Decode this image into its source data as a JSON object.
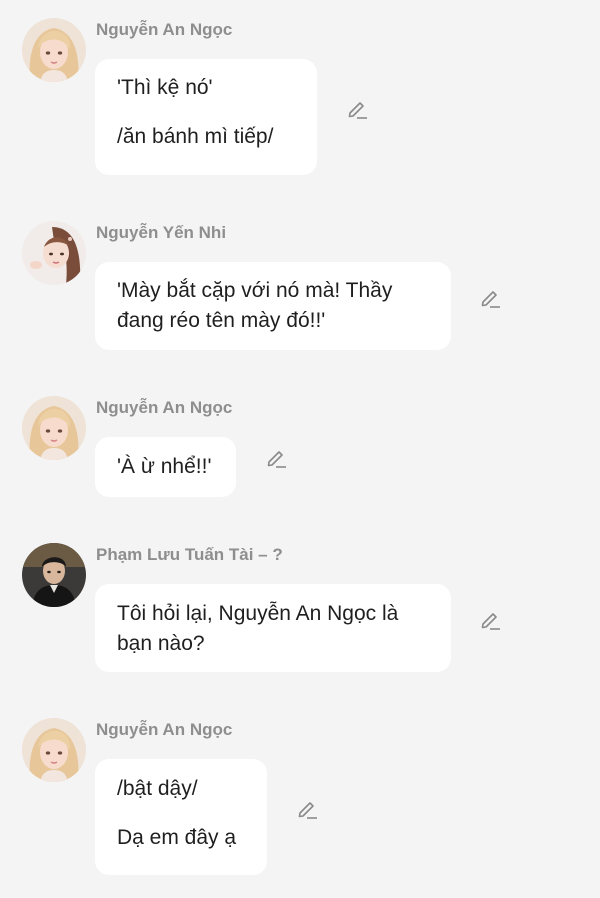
{
  "messages": [
    {
      "sender": "Nguyễn An Ngọc",
      "avatar_icon": "avatar-blonde-girl-icon",
      "lines": [
        "'Thì kệ nó'",
        "",
        "/ăn bánh mì tiếp/"
      ]
    },
    {
      "sender": "Nguyễn Yến Nhi",
      "avatar_icon": "avatar-brunette-girl-icon",
      "lines": [
        "'Mày bắt cặp với nó mà! Thầy",
        "đang réo tên mày đó!!'"
      ]
    },
    {
      "sender": "Nguyễn An Ngọc",
      "avatar_icon": "avatar-blonde-girl-icon",
      "lines": [
        "'À ừ nhể!!'"
      ]
    },
    {
      "sender": "Phạm Lưu Tuấn Tài – ?",
      "avatar_icon": "avatar-dark-haired-boy-icon",
      "lines": [
        "Tôi hỏi lại, Nguyễn An Ngọc là",
        "bạn nào?"
      ]
    },
    {
      "sender": "Nguyễn An Ngọc",
      "avatar_icon": "avatar-blonde-girl-icon",
      "lines": [
        "/bật dậy/",
        "",
        "Dạ em đây ạ"
      ]
    }
  ],
  "colors": {
    "background": "#f4f4f4",
    "bubble": "#ffffff",
    "sender_text": "#8e8e8e",
    "message_text": "#1f1f1f",
    "icon": "#8a8a8a"
  }
}
